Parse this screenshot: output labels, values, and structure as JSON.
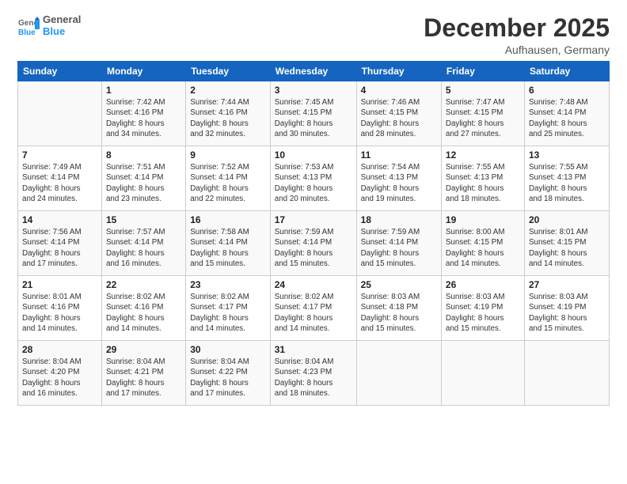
{
  "header": {
    "logo_general": "General",
    "logo_blue": "Blue",
    "month_title": "December 2025",
    "location": "Aufhausen, Germany"
  },
  "weekdays": [
    "Sunday",
    "Monday",
    "Tuesday",
    "Wednesday",
    "Thursday",
    "Friday",
    "Saturday"
  ],
  "weeks": [
    [
      {
        "day": "",
        "info": ""
      },
      {
        "day": "1",
        "info": "Sunrise: 7:42 AM\nSunset: 4:16 PM\nDaylight: 8 hours\nand 34 minutes."
      },
      {
        "day": "2",
        "info": "Sunrise: 7:44 AM\nSunset: 4:16 PM\nDaylight: 8 hours\nand 32 minutes."
      },
      {
        "day": "3",
        "info": "Sunrise: 7:45 AM\nSunset: 4:15 PM\nDaylight: 8 hours\nand 30 minutes."
      },
      {
        "day": "4",
        "info": "Sunrise: 7:46 AM\nSunset: 4:15 PM\nDaylight: 8 hours\nand 28 minutes."
      },
      {
        "day": "5",
        "info": "Sunrise: 7:47 AM\nSunset: 4:15 PM\nDaylight: 8 hours\nand 27 minutes."
      },
      {
        "day": "6",
        "info": "Sunrise: 7:48 AM\nSunset: 4:14 PM\nDaylight: 8 hours\nand 25 minutes."
      }
    ],
    [
      {
        "day": "7",
        "info": "Sunrise: 7:49 AM\nSunset: 4:14 PM\nDaylight: 8 hours\nand 24 minutes."
      },
      {
        "day": "8",
        "info": "Sunrise: 7:51 AM\nSunset: 4:14 PM\nDaylight: 8 hours\nand 23 minutes."
      },
      {
        "day": "9",
        "info": "Sunrise: 7:52 AM\nSunset: 4:14 PM\nDaylight: 8 hours\nand 22 minutes."
      },
      {
        "day": "10",
        "info": "Sunrise: 7:53 AM\nSunset: 4:13 PM\nDaylight: 8 hours\nand 20 minutes."
      },
      {
        "day": "11",
        "info": "Sunrise: 7:54 AM\nSunset: 4:13 PM\nDaylight: 8 hours\nand 19 minutes."
      },
      {
        "day": "12",
        "info": "Sunrise: 7:55 AM\nSunset: 4:13 PM\nDaylight: 8 hours\nand 18 minutes."
      },
      {
        "day": "13",
        "info": "Sunrise: 7:55 AM\nSunset: 4:13 PM\nDaylight: 8 hours\nand 18 minutes."
      }
    ],
    [
      {
        "day": "14",
        "info": "Sunrise: 7:56 AM\nSunset: 4:14 PM\nDaylight: 8 hours\nand 17 minutes."
      },
      {
        "day": "15",
        "info": "Sunrise: 7:57 AM\nSunset: 4:14 PM\nDaylight: 8 hours\nand 16 minutes."
      },
      {
        "day": "16",
        "info": "Sunrise: 7:58 AM\nSunset: 4:14 PM\nDaylight: 8 hours\nand 15 minutes."
      },
      {
        "day": "17",
        "info": "Sunrise: 7:59 AM\nSunset: 4:14 PM\nDaylight: 8 hours\nand 15 minutes."
      },
      {
        "day": "18",
        "info": "Sunrise: 7:59 AM\nSunset: 4:14 PM\nDaylight: 8 hours\nand 15 minutes."
      },
      {
        "day": "19",
        "info": "Sunrise: 8:00 AM\nSunset: 4:15 PM\nDaylight: 8 hours\nand 14 minutes."
      },
      {
        "day": "20",
        "info": "Sunrise: 8:01 AM\nSunset: 4:15 PM\nDaylight: 8 hours\nand 14 minutes."
      }
    ],
    [
      {
        "day": "21",
        "info": "Sunrise: 8:01 AM\nSunset: 4:16 PM\nDaylight: 8 hours\nand 14 minutes."
      },
      {
        "day": "22",
        "info": "Sunrise: 8:02 AM\nSunset: 4:16 PM\nDaylight: 8 hours\nand 14 minutes."
      },
      {
        "day": "23",
        "info": "Sunrise: 8:02 AM\nSunset: 4:17 PM\nDaylight: 8 hours\nand 14 minutes."
      },
      {
        "day": "24",
        "info": "Sunrise: 8:02 AM\nSunset: 4:17 PM\nDaylight: 8 hours\nand 14 minutes."
      },
      {
        "day": "25",
        "info": "Sunrise: 8:03 AM\nSunset: 4:18 PM\nDaylight: 8 hours\nand 15 minutes."
      },
      {
        "day": "26",
        "info": "Sunrise: 8:03 AM\nSunset: 4:19 PM\nDaylight: 8 hours\nand 15 minutes."
      },
      {
        "day": "27",
        "info": "Sunrise: 8:03 AM\nSunset: 4:19 PM\nDaylight: 8 hours\nand 15 minutes."
      }
    ],
    [
      {
        "day": "28",
        "info": "Sunrise: 8:04 AM\nSunset: 4:20 PM\nDaylight: 8 hours\nand 16 minutes."
      },
      {
        "day": "29",
        "info": "Sunrise: 8:04 AM\nSunset: 4:21 PM\nDaylight: 8 hours\nand 17 minutes."
      },
      {
        "day": "30",
        "info": "Sunrise: 8:04 AM\nSunset: 4:22 PM\nDaylight: 8 hours\nand 17 minutes."
      },
      {
        "day": "31",
        "info": "Sunrise: 8:04 AM\nSunset: 4:23 PM\nDaylight: 8 hours\nand 18 minutes."
      },
      {
        "day": "",
        "info": ""
      },
      {
        "day": "",
        "info": ""
      },
      {
        "day": "",
        "info": ""
      }
    ]
  ]
}
